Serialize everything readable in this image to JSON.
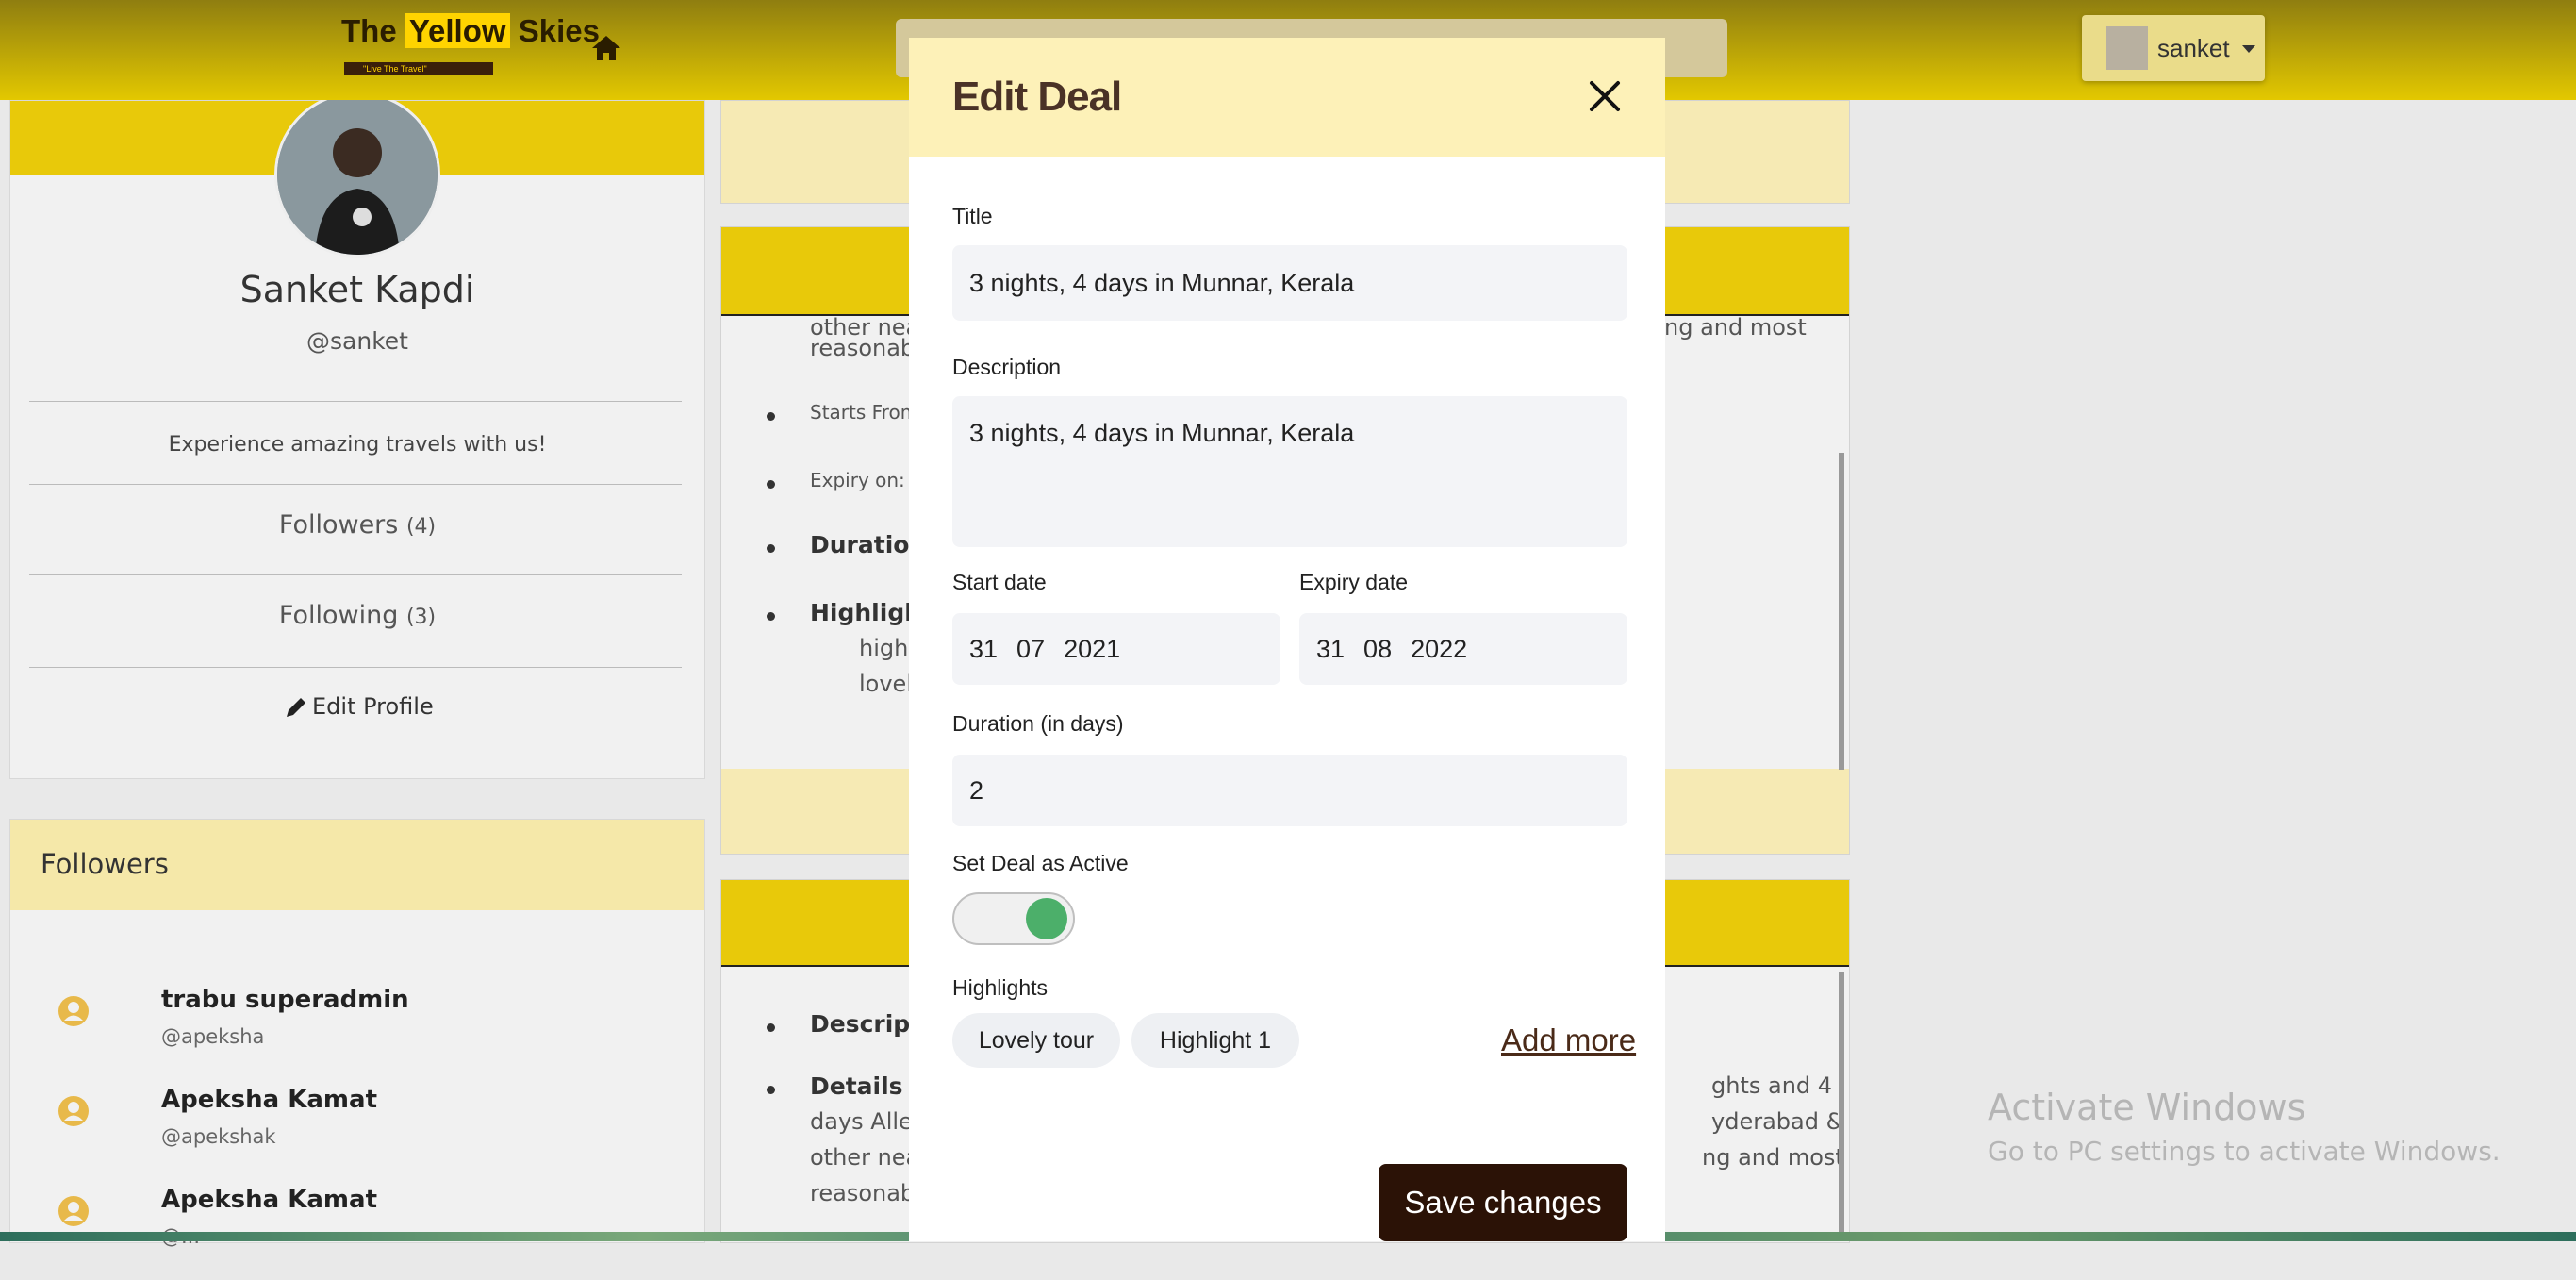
{
  "navbar": {
    "brand_prefix": "The",
    "brand_highlight": "Yellow",
    "brand_suffix": "Skies",
    "brand_tagline": "\"Live The Travel\"",
    "user_name": "sanket"
  },
  "profile": {
    "name": "Sanket Kapdi",
    "handle": "@sanket",
    "bio": "Experience amazing travels with us!",
    "followers_label": "Followers",
    "followers_count": "(4)",
    "following_label": "Following",
    "following_count": "(3)",
    "edit_label": "Edit Profile"
  },
  "followers_section": {
    "title": "Followers",
    "items": [
      {
        "name": "trabu superadmin",
        "handle": "@apeksha"
      },
      {
        "name": "Apeksha Kamat",
        "handle": "@apekshak"
      },
      {
        "name": "Apeksha Kamat",
        "handle": "@..."
      }
    ]
  },
  "deal_background": {
    "card1": {
      "line_top_left": "other nea",
      "line_top_right": "ng and most",
      "line2_left": "reasonabl",
      "starts_from": "Starts From",
      "expiry_on": "Expiry on: A",
      "duration": "Duration",
      "highlights": "Highlight",
      "hl_line1": "highl",
      "hl_line2": "lovel"
    },
    "card2": {
      "description": "Descripti",
      "details": "Details :",
      "details_rest": "days Allep",
      "other": "other nea",
      "reasonable": "reasonabl",
      "right1": "ghts and 4",
      "right2": "yderabad &",
      "right3": "ng and most"
    }
  },
  "modal": {
    "title": "Edit Deal",
    "title_label": "Title",
    "title_value": "3 nights, 4 days in Munnar, Kerala",
    "description_label": "Description",
    "description_value": "3 nights, 4 days in Munnar, Kerala",
    "start_date_label": "Start date",
    "start_date": {
      "day": "31",
      "month": "07",
      "year": "2021"
    },
    "expiry_date_label": "Expiry date",
    "expiry_date": {
      "day": "31",
      "month": "08",
      "year": "2022"
    },
    "duration_label": "Duration (in days)",
    "duration_value": "2",
    "active_label": "Set Deal as Active",
    "active": true,
    "highlights_label": "Highlights",
    "highlights": [
      "Lovely tour",
      "Highlight 1"
    ],
    "add_more_label": "Add more",
    "save_label": "Save changes"
  },
  "watermark": {
    "title": "Activate Windows",
    "subtitle": "Go to PC settings to activate Windows."
  },
  "colors": {
    "navbar": "#e3c800",
    "modal_header": "#fdf1b8",
    "save_button": "#2b1206",
    "toggle_on": "#4caf6a"
  }
}
